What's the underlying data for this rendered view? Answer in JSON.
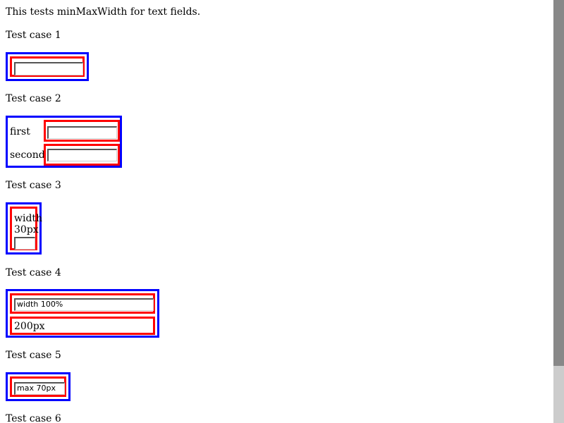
{
  "intro": "This tests minMaxWidth for text fields.",
  "cases": [
    {
      "heading": "Test case 1"
    },
    {
      "heading": "Test case 2",
      "labels": [
        "first",
        "second"
      ]
    },
    {
      "heading": "Test case 3",
      "text_line1": "width",
      "text_line2": "30px"
    },
    {
      "heading": "Test case 4",
      "field_value": "width 100%",
      "label": "200px"
    },
    {
      "heading": "Test case 5",
      "field_value": "max 70px"
    },
    {
      "heading": "Test case 6"
    }
  ],
  "colors": {
    "outer_border": "#0000ff",
    "inner_border": "#ff0000",
    "scrollbar_track": "#cccccc",
    "scrollbar_thumb": "#888888"
  }
}
